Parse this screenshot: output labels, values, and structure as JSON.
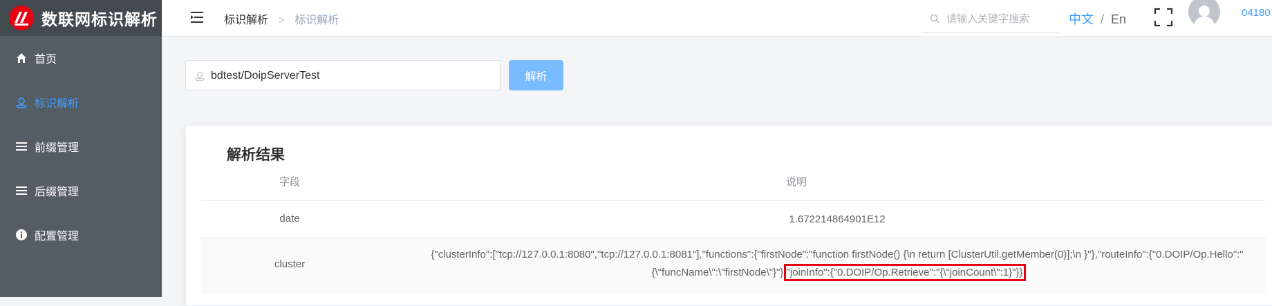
{
  "app": {
    "title": "数联网标识解析"
  },
  "sidebar": {
    "items": [
      {
        "label": "首页",
        "icon": "home-icon",
        "active": false
      },
      {
        "label": "标识解析",
        "icon": "location-icon",
        "active": true
      },
      {
        "label": "前缀管理",
        "icon": "list-icon",
        "active": false
      },
      {
        "label": "后缀管理",
        "icon": "list-icon",
        "active": false
      },
      {
        "label": "配置管理",
        "icon": "info-icon",
        "active": false
      }
    ]
  },
  "header": {
    "breadcrumb": [
      "标识解析",
      "标识解析"
    ],
    "search_placeholder": "请输入关键字搜索",
    "lang_zh": "中文",
    "lang_sep": "/",
    "lang_en": "En",
    "user_id": "04180"
  },
  "query": {
    "value": "bdtest/DoipServerTest",
    "button_label": "解析"
  },
  "result": {
    "title": "解析结果",
    "columns": [
      "字段",
      "说明"
    ],
    "rows": [
      {
        "field": "date",
        "value": "1.672214864901E12"
      },
      {
        "field": "cluster",
        "value_line1": "{\"clusterInfo\":[\"tcp://127.0.0.1:8080\",\"tcp://127.0.0.1:8081\"],\"functions\":{\"firstNode\":\"function firstNode() {\\n return [ClusterUtil.getMember(0)];\\n }\"},\"routeInfo\":{\"0.DOIP/Op.Hello\":\"",
        "value_line2_a": "{\\\"funcName\\\":\\\"firstNode\\\"}\"},",
        "value_line2_b": "\"joinInfo\":{\"0.DOIP/Op.Retrieve\":\"{\\\"joinCount\\\":1}\"}}"
      }
    ]
  },
  "colors": {
    "accent": "#409eff",
    "sidebar_bg": "#545c64",
    "highlight": "#e60012"
  }
}
